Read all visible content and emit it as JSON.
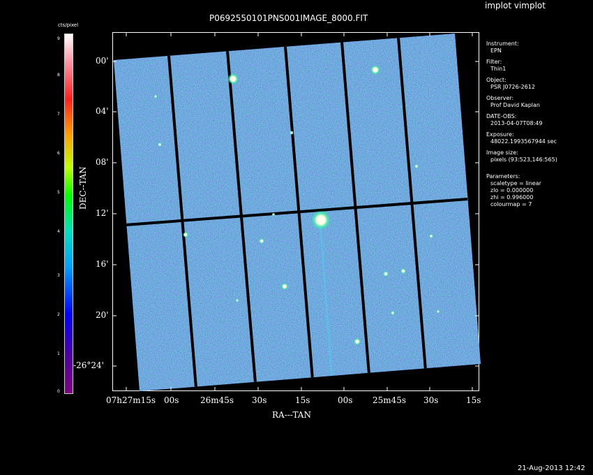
{
  "app_title": "implot vimplot",
  "plot_title": "P0692550101PNS001IMAGE_8000.FIT",
  "colorbar": {
    "title": "cts/pixel",
    "ticks": [
      "0",
      "1",
      "2",
      "3",
      "4",
      "5",
      "6",
      "7",
      "8",
      "9"
    ]
  },
  "axes": {
    "xlabel": "RA---TAN",
    "ylabel": "DEC--TAN",
    "x_ticks": [
      "07h27m15s",
      "00s",
      "26m45s",
      "30s",
      "15s",
      "00s",
      "25m45s",
      "30s",
      "15s"
    ],
    "y_ticks": [
      "00'",
      "04'",
      "08'",
      "12'",
      "16'",
      "20'",
      "-26°24'"
    ]
  },
  "info": {
    "instrument_label": "Instrument:",
    "instrument": "EPN",
    "filter_label": "Filter:",
    "filter": "Thin1",
    "object_label": "Object:",
    "object": "PSR J0726-2612",
    "observer_label": "Observer:",
    "observer": "Prof David Kaplan",
    "date_label": "DATE-OBS:",
    "date": "2013-04-07T08:49",
    "exposure_label": "Exposure:",
    "exposure": "48022.1993567944 sec",
    "image_size_label": "Image size:",
    "image_size": "pixels (93:523,146:565)",
    "parameters_label": "Parameters:",
    "scaletype": "scaletype = linear",
    "zlo": "zlo = 0.000000",
    "zhi": "zhi = 0.996000",
    "colourmap": "colourmap =   7"
  },
  "timestamp": "21-Aug-2013 12:42",
  "colors": {
    "background": "#000000",
    "detector": "#2a1fb0"
  }
}
